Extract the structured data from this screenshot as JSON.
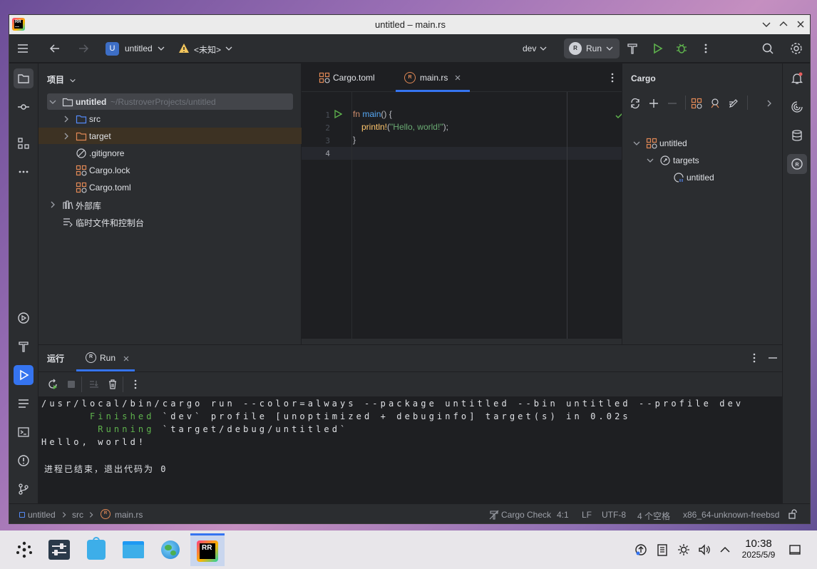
{
  "window": {
    "title": "untitled – main.rs"
  },
  "toolbar": {
    "project_badge": "U",
    "project_name": "untitled",
    "vcs_label": "<未知>",
    "profile": "dev",
    "run_label": "Run"
  },
  "project_panel": {
    "title": "项目",
    "root_name": "untitled",
    "root_path": "~/RustroverProjects/untitled",
    "items": [
      {
        "label": "src"
      },
      {
        "label": "target"
      },
      {
        "label": ".gitignore"
      },
      {
        "label": "Cargo.lock"
      },
      {
        "label": "Cargo.toml"
      },
      {
        "label": "外部库"
      },
      {
        "label": "临时文件和控制台"
      }
    ]
  },
  "editor": {
    "tabs": [
      {
        "label": "Cargo.toml"
      },
      {
        "label": "main.rs"
      }
    ],
    "line_numbers": [
      "1",
      "2",
      "3",
      "4"
    ],
    "code": {
      "l1_kw": "fn",
      "l1_fn": "main",
      "l1_rest": "() {",
      "l2_macro": "println!",
      "l2_open": "(",
      "l2_str": "\"Hello, world!\"",
      "l2_close": ");",
      "l3": "}"
    }
  },
  "cargo_panel": {
    "title": "Cargo",
    "tree": [
      {
        "label": "untitled"
      },
      {
        "label": "targets"
      },
      {
        "label": "untitled"
      }
    ]
  },
  "run_panel": {
    "title": "运行",
    "tab_label": "Run",
    "console": {
      "cmd": "/usr/local/bin/cargo run --color=always --package untitled --bin untitled --profile dev",
      "finished_word": "Finished",
      "finished_rest": " `dev` profile [unoptimized + debuginfo] target(s) in 0.02s",
      "running_word": "Running",
      "running_rest": " `target/debug/untitled`",
      "output": "Hello, world!",
      "exit": "进程已结束，退出代码为 0"
    }
  },
  "statusbar": {
    "crumbs": [
      "untitled",
      "src",
      "main.rs"
    ],
    "cargo_check": "Cargo Check",
    "position": "4:1",
    "line_sep": "LF",
    "encoding": "UTF-8",
    "indent": "4 个空格",
    "target": "x86_64-unknown-freebsd"
  },
  "taskbar": {
    "app_active_label": "RR",
    "time": "10:38",
    "date": "2025/5/9"
  },
  "colors": {
    "accent": "#3574f0",
    "panel_bg": "#2b2d30",
    "editor_bg": "#1e1f22",
    "run_green": "#5fb34d"
  }
}
